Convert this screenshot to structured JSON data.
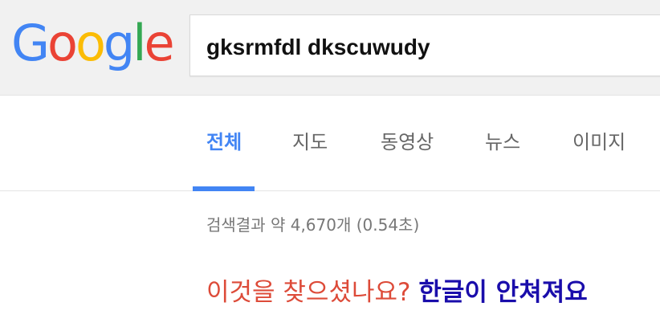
{
  "brand": {
    "logo_letters": [
      {
        "char": "G",
        "color": "#4285f4"
      },
      {
        "char": "o",
        "color": "#ea4335"
      },
      {
        "char": "o",
        "color": "#fbbc05"
      },
      {
        "char": "g",
        "color": "#4285f4"
      },
      {
        "char": "l",
        "color": "#34a853"
      },
      {
        "char": "e",
        "color": "#ea4335"
      }
    ]
  },
  "search": {
    "query": "gksrmfdl dkscuwudy"
  },
  "tabs": [
    {
      "label": "전체",
      "active": true
    },
    {
      "label": "지도",
      "active": false
    },
    {
      "label": "동영상",
      "active": false
    },
    {
      "label": "뉴스",
      "active": false
    },
    {
      "label": "이미지",
      "active": false
    }
  ],
  "results": {
    "stats": "검색결과 약 4,670개 (0.54초)",
    "did_you_mean_label": "이것을 찾으셨나요?",
    "did_you_mean_suggestion": "한글이 안쳐져요"
  },
  "colors": {
    "accent": "#4285f4",
    "suggestion_label": "#dd4b39",
    "link": "#1a0dab"
  }
}
